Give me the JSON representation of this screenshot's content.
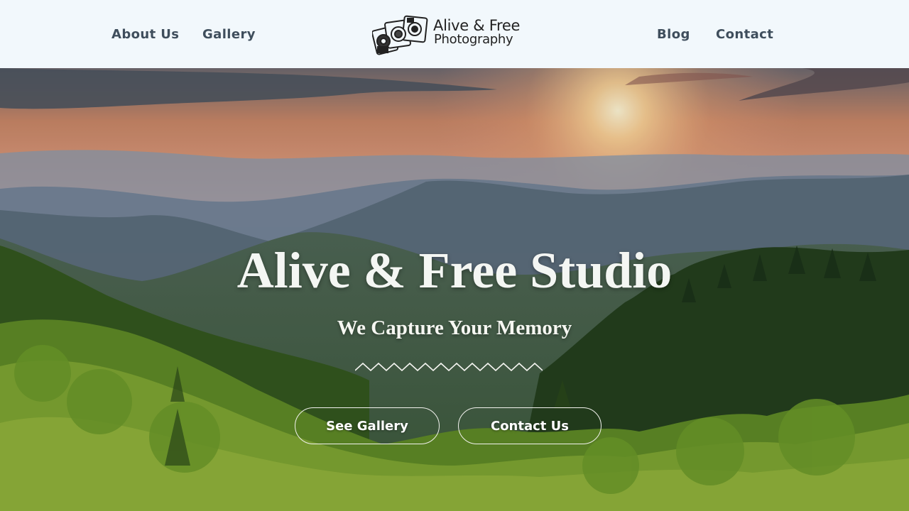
{
  "nav": {
    "about": "About Us",
    "gallery": "Gallery",
    "blog": "Blog",
    "contact": "Contact"
  },
  "logo": {
    "line1": "Alive & Free",
    "line2": "Photography",
    "icon": "camera-collage-icon"
  },
  "hero": {
    "title": "Alive & Free Studio",
    "subtitle": "We Capture Your Memory",
    "divider_icon": "zigzag-divider-icon",
    "primary_button": "See Gallery",
    "secondary_button": "Contact Us"
  },
  "colors": {
    "header_bg": "#f2f8fc",
    "nav_text": "#3f4e5c",
    "hero_text": "#f4f6f3"
  }
}
